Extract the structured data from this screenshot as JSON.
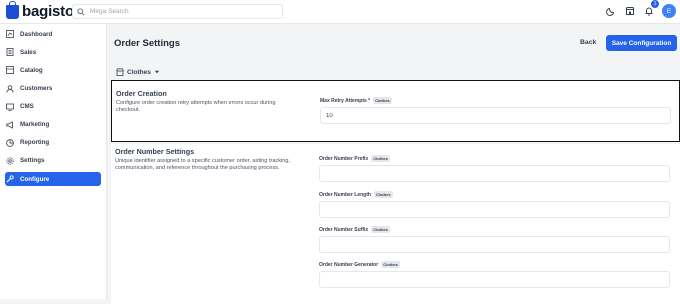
{
  "app": {
    "name": "bagisto"
  },
  "search": {
    "placeholder": "Mega Search"
  },
  "header": {
    "notification_count": "1",
    "avatar_initial": "E"
  },
  "sidebar": {
    "items": [
      {
        "label": "Dashboard",
        "icon": "dashboard-icon"
      },
      {
        "label": "Sales",
        "icon": "sales-icon"
      },
      {
        "label": "Catalog",
        "icon": "catalog-icon"
      },
      {
        "label": "Customers",
        "icon": "customers-icon"
      },
      {
        "label": "CMS",
        "icon": "cms-icon"
      },
      {
        "label": "Marketing",
        "icon": "marketing-icon"
      },
      {
        "label": "Reporting",
        "icon": "reporting-icon"
      },
      {
        "label": "Settings",
        "icon": "settings-icon"
      },
      {
        "label": "Configure",
        "icon": "configure-icon",
        "active": true
      }
    ]
  },
  "page": {
    "title": "Order Settings",
    "back_label": "Back",
    "save_label": "Save Configuration",
    "channel": "Clothes"
  },
  "sections": {
    "order_creation": {
      "title": "Order Creation",
      "description": "Configure order creation retry attempts when errors occur during checkout.",
      "fields": {
        "max_retry": {
          "label": "Max Retry Attempts *",
          "chip": "Clothes",
          "value": "10"
        }
      }
    },
    "order_number": {
      "title": "Order Number Settings",
      "description": "Unique identifier assigned to a specific customer order, aiding tracking, communication, and reference throughout the purchasing process.",
      "fields": {
        "prefix": {
          "label": "Order Number Prefix",
          "chip": "Clothes",
          "value": ""
        },
        "length": {
          "label": "Order Number Length",
          "chip": "Clothes",
          "value": ""
        },
        "suffix": {
          "label": "Order Number Suffix",
          "chip": "Clothes",
          "value": ""
        },
        "generator": {
          "label": "Order Number Generator",
          "chip": "Clothes",
          "value": ""
        }
      }
    }
  },
  "colors": {
    "accent": "#2563eb",
    "background": "#f3f4f6",
    "surface": "#ffffff"
  }
}
